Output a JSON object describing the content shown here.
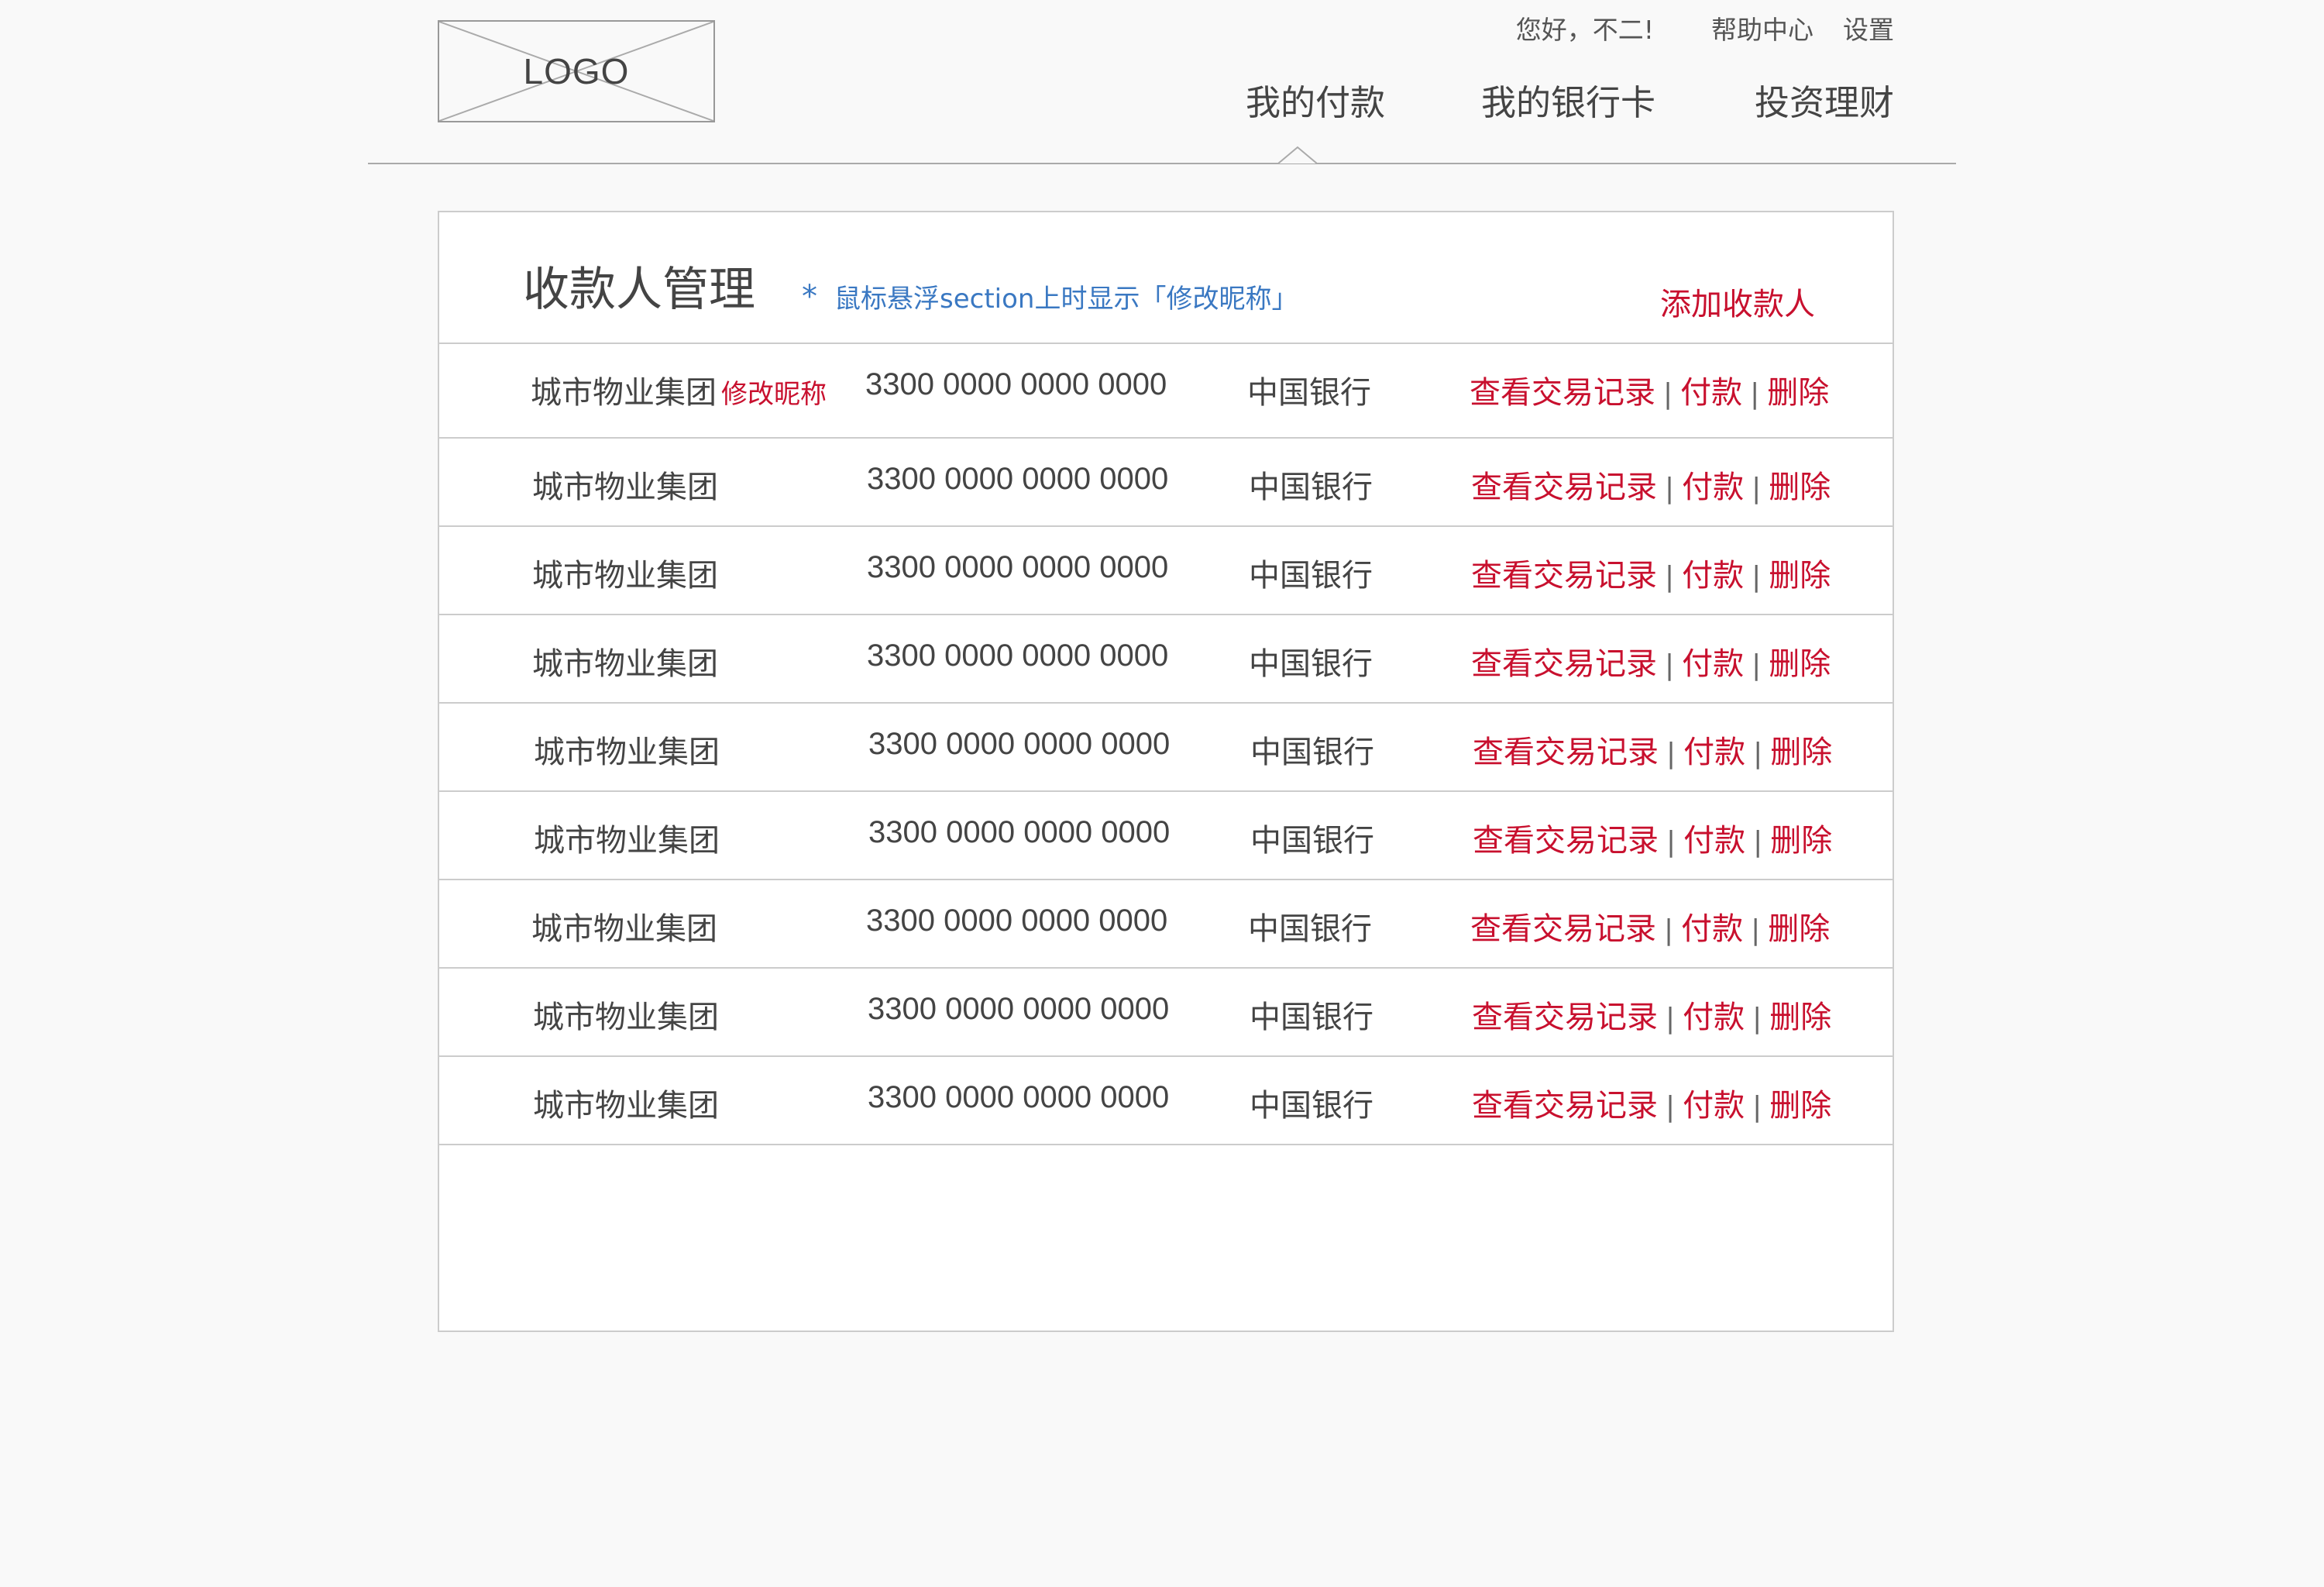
{
  "header": {
    "logo_text": "LOGO",
    "greeting": "您好，不二!",
    "help_label": "帮助中心",
    "settings_label": "设置",
    "nav": [
      "我的付款",
      "我的银行卡",
      "投资理财"
    ]
  },
  "panel": {
    "title": "收款人管理",
    "hint_star": "*",
    "hint_text": "鼠标悬浮section上时显示「修改昵称」",
    "add_label": "添加收款人",
    "edit_nickname_label": "修改昵称",
    "actions": {
      "view_records": "查看交易记录",
      "pay": "付款",
      "delete": "删除",
      "separator": "|"
    },
    "rows": [
      {
        "name": "城市物业集团",
        "card": "3300 0000 0000 0000",
        "bank": "中国银行"
      },
      {
        "name": "城市物业集团",
        "card": "3300 0000 0000 0000",
        "bank": "中国银行"
      },
      {
        "name": "城市物业集团",
        "card": "3300 0000 0000 0000",
        "bank": "中国银行"
      },
      {
        "name": "城市物业集团",
        "card": "3300 0000 0000 0000",
        "bank": "中国银行"
      },
      {
        "name": "城市物业集团",
        "card": "3300 0000 0000 0000",
        "bank": "中国银行"
      },
      {
        "name": "城市物业集团",
        "card": "3300 0000 0000 0000",
        "bank": "中国银行"
      },
      {
        "name": "城市物业集团",
        "card": "3300 0000 0000 0000",
        "bank": "中国银行"
      },
      {
        "name": "城市物业集团",
        "card": "3300 0000 0000 0000",
        "bank": "中国银行"
      },
      {
        "name": "城市物业集团",
        "card": "3300 0000 0000 0000",
        "bank": "中国银行"
      }
    ]
  },
  "colors": {
    "accent_red": "#c8102e",
    "hint_blue": "#3a78c2"
  }
}
